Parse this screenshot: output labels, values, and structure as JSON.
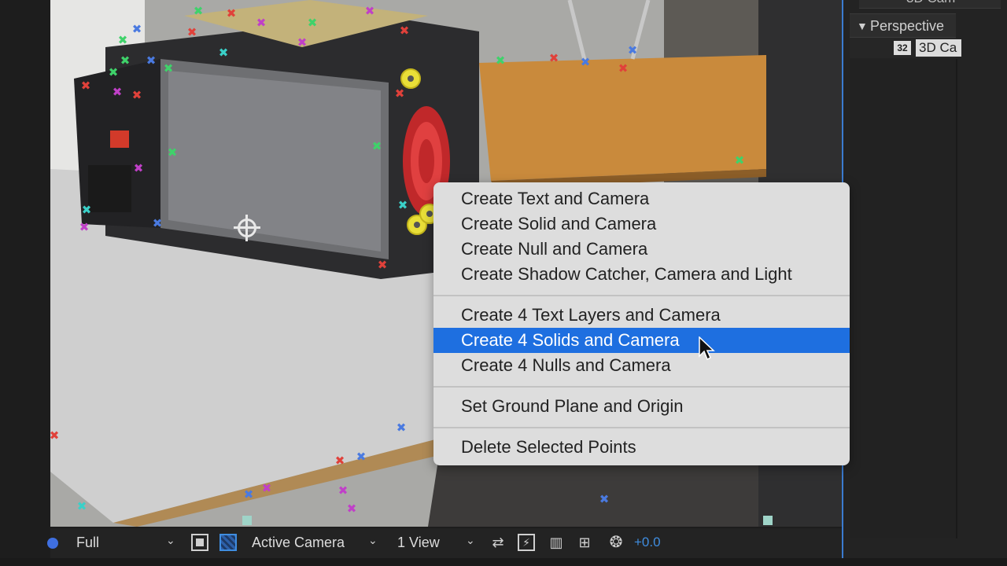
{
  "right_panel": {
    "top_partial_label": "3D Cam",
    "perspective_label": "Perspective",
    "camera_badge": "32",
    "camera_name": "3D Ca"
  },
  "context_menu": {
    "items": [
      {
        "label": "Create Text and Camera",
        "selected": false
      },
      {
        "label": "Create Solid and Camera",
        "selected": false
      },
      {
        "label": "Create Null and Camera",
        "selected": false
      },
      {
        "label": "Create Shadow Catcher, Camera and Light",
        "selected": false
      },
      {
        "label": "Create 4 Text Layers and Camera",
        "selected": false
      },
      {
        "label": "Create 4 Solids and Camera",
        "selected": true
      },
      {
        "label": "Create 4 Nulls and Camera",
        "selected": false
      },
      {
        "label": "Set Ground Plane and Origin",
        "selected": false
      },
      {
        "label": "Delete Selected Points",
        "selected": false
      }
    ]
  },
  "toolbar": {
    "resolution": "Full",
    "view": "Active Camera",
    "layout": "1 View",
    "exposure": "+0.0"
  },
  "colors": {
    "selection": "#1e6fe0",
    "accent_blue": "#3f8de0",
    "track_green": "#3fd26a",
    "track_red": "#e0413a",
    "track_purple": "#c040c8",
    "track_blue": "#4a7ae0",
    "track_cyan": "#3ad0c8"
  }
}
